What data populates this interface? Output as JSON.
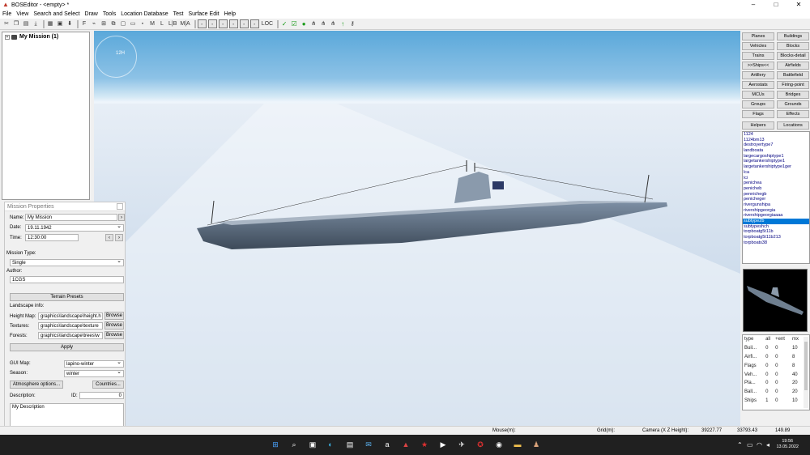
{
  "window": {
    "title": "BOSEditor - <empty> *"
  },
  "menu": [
    "File",
    "View",
    "Search and Select",
    "Draw",
    "Tools",
    "Location Database",
    "Test",
    "Surface Edit",
    "Help"
  ],
  "toolbar": {
    "text_buttons": [
      "F",
      "M",
      "L",
      "L|B",
      "M|A",
      "LOC"
    ]
  },
  "tree": {
    "root_label": "My Mission (1)"
  },
  "compass_label": "12H",
  "mission_properties": {
    "title": "Mission Properties",
    "name_label": "Name:",
    "name_value": "My Mission",
    "date_label": "Date:",
    "date_value": "19.11.1942",
    "time_label": "Time:",
    "time_value": "12:30:00",
    "mission_type_label": "Mission Type:",
    "mission_type_value": "Single",
    "author_label": "Author:",
    "author_value": "1CGS",
    "terrain_presets": "Terrain Presets",
    "landscape_info_label": "Landscape info:",
    "height_map_label": "Height Map:",
    "height_map_value": "graphics\\landscape\\height.h",
    "textures_label": "Textures:",
    "textures_value": "graphics\\landscape\\texture",
    "forests_label": "Forests:",
    "forests_value": "graphics\\landscape\\trees\\w",
    "browse": "Browse",
    "apply": "Apply",
    "gui_map_label": "GUI Map:",
    "gui_map_value": "lapino-winter",
    "season_label": "Season:",
    "season_value": "winter",
    "atmosphere_options": "Atmosphere options...",
    "countries": "Countries...",
    "description_label": "Description:",
    "id_label": "ID:",
    "id_value": "0",
    "description_value": "My Description"
  },
  "categories": [
    [
      "Planes",
      "Buildings"
    ],
    [
      "Vehicles",
      "Blocks"
    ],
    [
      "Trains",
      "Blocks-detail"
    ],
    [
      ">>Ships<<",
      "Airfields"
    ],
    [
      "Artillery",
      "Battlefield"
    ],
    [
      "Aerostats",
      "Firing-point"
    ],
    [
      "MCUs",
      "Bridges"
    ],
    [
      "Groups",
      "Grounds"
    ],
    [
      "Flags",
      "Effects"
    ],
    [
      "Helpers",
      "Locations"
    ]
  ],
  "object_list": [
    "1124",
    "1124bm13",
    "destroyertype7",
    "landboata",
    "largecargoshiptype1",
    "largetankershiptype1",
    "largetankershiptype1ger",
    "lca",
    "lci",
    "penichea",
    "penicheb",
    "pennichegb",
    "penicheger",
    "rivergunshipa",
    "rivershipgeorgia",
    "rivershipgeorgiaaaa",
    "subtype2b",
    "subtypeshch",
    "torpboatg5t11b",
    "torpboatg5t11b213",
    "torpboats38"
  ],
  "object_list_selected_index": 16,
  "stats": {
    "headers": [
      "type",
      "all",
      "+ent",
      "mx"
    ],
    "rows": [
      [
        "Buil...",
        "0",
        "0",
        "10"
      ],
      [
        "Airfi...",
        "0",
        "0",
        "8"
      ],
      [
        "Flags",
        "0",
        "0",
        "8"
      ],
      [
        "Veh...",
        "0",
        "0",
        "40"
      ],
      [
        "Pla...",
        "0",
        "0",
        "20"
      ],
      [
        "Ball...",
        "0",
        "0",
        "20"
      ],
      [
        "Ships",
        "1",
        "0",
        "10"
      ]
    ]
  },
  "statusbar": {
    "mouse_label": "Mouse(m):",
    "grid_label": "Grid(m):",
    "camera_label": "Camera (X Z Height):",
    "camera_x": "39227.77",
    "camera_z": "33793.43",
    "camera_height": "149.89"
  },
  "clock": {
    "time": "19:56",
    "date": "13.05.2022"
  }
}
